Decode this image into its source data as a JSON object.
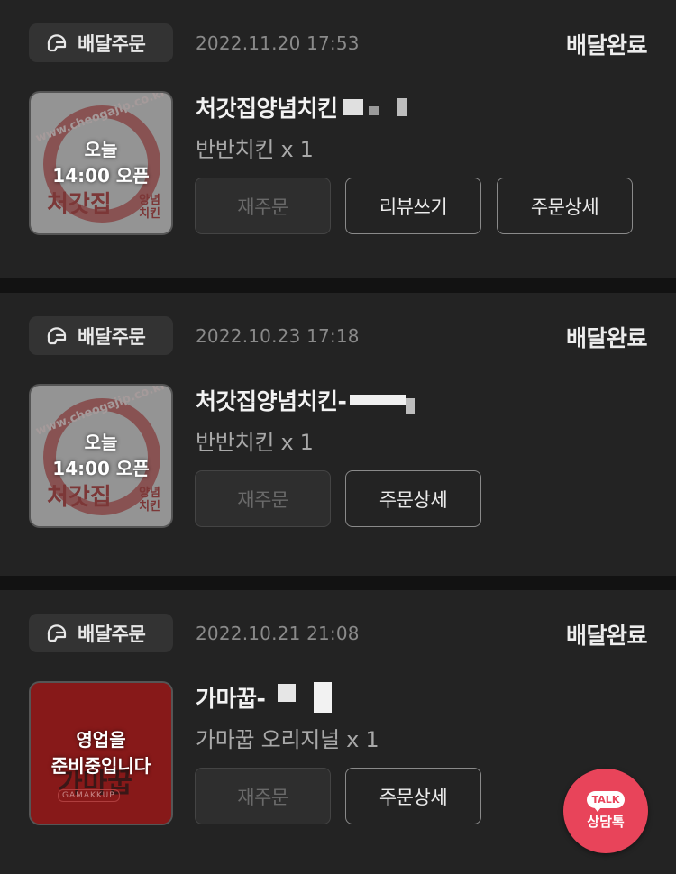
{
  "orders": [
    {
      "type_label": "배달주문",
      "type_icon": "scooter-helmet-icon",
      "date": "2022.11.20 17:53",
      "status": "배달완료",
      "store_name": "처갓집양념치킨",
      "thumb_overlay_line1": "오늘",
      "thumb_overlay_line2": "14:00 오픈",
      "thumb_brand": "처갓집",
      "thumb_brand_sub": "양념\n치킨",
      "thumb_ring_text": "www.cheogajip.co.kr",
      "item": "반반치킨 x 1",
      "buttons": [
        "재주문",
        "리뷰쓰기",
        "주문상세"
      ]
    },
    {
      "type_label": "배달주문",
      "type_icon": "scooter-helmet-icon",
      "date": "2022.10.23 17:18",
      "status": "배달완료",
      "store_name": "처갓집양념치킨-",
      "thumb_overlay_line1": "오늘",
      "thumb_overlay_line2": "14:00 오픈",
      "thumb_brand": "처갓집",
      "thumb_brand_sub": "양념\n치킨",
      "thumb_ring_text": "www.cheogajip.co.kr",
      "item": "반반치킨 x 1",
      "buttons": [
        "재주문",
        "주문상세"
      ]
    },
    {
      "type_label": "배달주문",
      "type_icon": "scooter-helmet-icon",
      "date": "2022.10.21 21:08",
      "status": "배달완료",
      "store_name": "가마꿉-",
      "thumb_overlay_line1": "영업을",
      "thumb_overlay_line2": "준비중입니다",
      "thumb_brand": "가마꿉",
      "thumb_brand_sub": "GAMAKKUP",
      "item": "가마꿉 오리지널 x 1",
      "buttons": [
        "재주문",
        "주문상세"
      ]
    }
  ],
  "talk_fab": {
    "bubble": "TALK",
    "label": "상담톡"
  },
  "colors": {
    "background": "#121212",
    "card": "#232323",
    "fab": "#e8445a"
  }
}
